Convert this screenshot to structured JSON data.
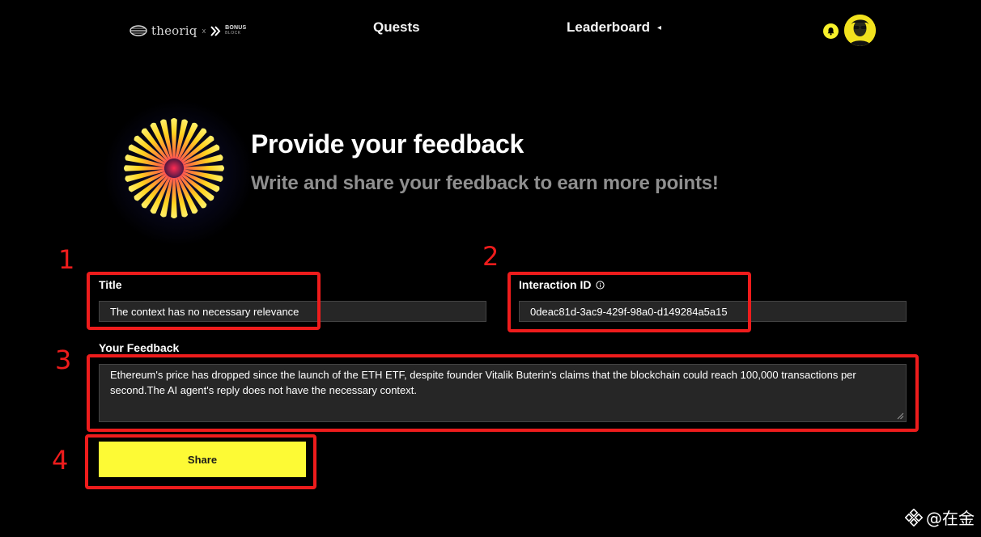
{
  "nav": {
    "logo": {
      "brand": "theoriq",
      "separator": "x",
      "partner_line1": "BONUS",
      "partner_line2": "BLOCK",
      "icon": "theoriq-logo-icon"
    },
    "quests_label": "Quests",
    "leaderboard_label": "Leaderboard",
    "leaderboard_caret": "◂",
    "notification_icon": "bell-icon",
    "avatar_icon": "user-avatar"
  },
  "hero": {
    "title": "Provide your feedback",
    "subtitle": "Write and share your feedback to earn more points!"
  },
  "form": {
    "title_label": "Title",
    "title_value": "The context has no necessary relevance",
    "interaction_label": "Interaction ID",
    "interaction_info_icon": "info-icon",
    "interaction_value": "0deac81d-3ac9-429f-98a0-d149284a5a15",
    "feedback_label": "Your Feedback",
    "feedback_value": "Ethereum's price has dropped since the launch of the ETH ETF, despite founder Vitalik Buterin's claims that the blockchain could reach 100,000 transactions per second.The AI agent's reply does not have the necessary context.",
    "share_label": "Share"
  },
  "annotations": [
    "1",
    "2",
    "3",
    "4"
  ],
  "watermark": {
    "text": "@在金",
    "icon": "binance-logo-icon"
  },
  "colors": {
    "background": "#000000",
    "accent_yellow": "#fdfa35",
    "input_bg": "#262626",
    "annotation_red": "#ee1c1c",
    "subtitle_gray": "#8f8f8f"
  }
}
